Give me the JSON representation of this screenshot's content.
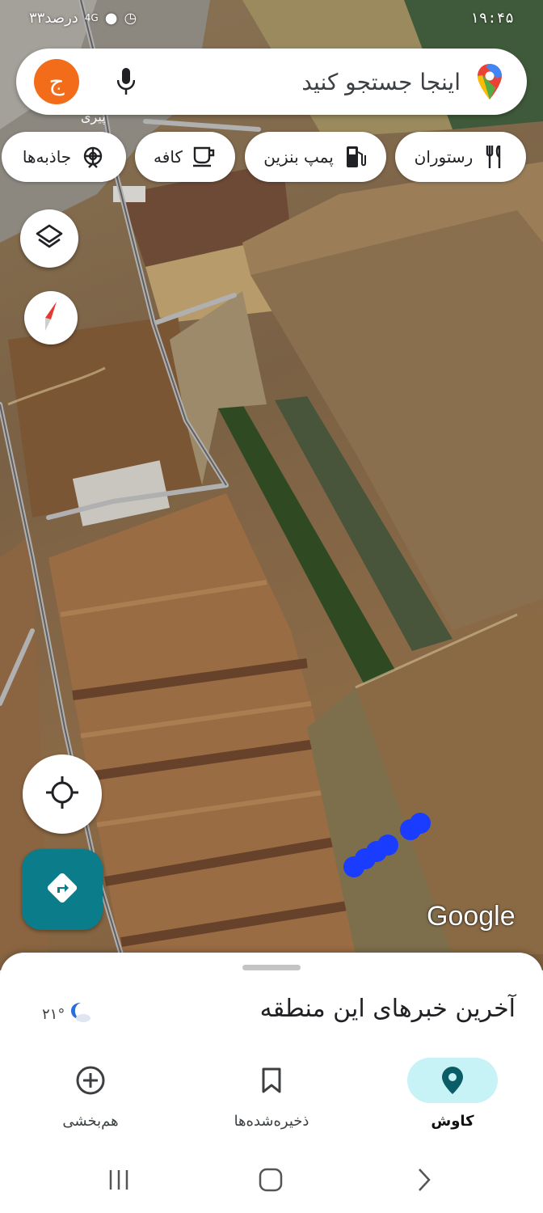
{
  "status_bar": {
    "time": "۱۹:۴۵",
    "battery": "۳۳درصد",
    "network": "4G"
  },
  "search": {
    "placeholder": "اینجا جستجو کنید",
    "avatar_letter": "ج",
    "icons": {
      "logo": "maps-pin-icon",
      "mic": "mic-icon"
    }
  },
  "chips": [
    {
      "label": "رستوران",
      "icon": "restaurant-icon"
    },
    {
      "label": "پمپ بنزین",
      "icon": "gas-station-icon"
    },
    {
      "label": "کافه",
      "icon": "cafe-icon"
    },
    {
      "label": "جاذبه‌ها",
      "icon": "attractions-icon"
    }
  ],
  "map": {
    "attribution": "Google",
    "place_label": "پیری",
    "route_color": "#1a3cff"
  },
  "sheet": {
    "news_title": "آخرین خبرهای این منطقه",
    "weather_temp": "۲۱°",
    "weather_icon": "moon-cloud-icon"
  },
  "bottom_nav": [
    {
      "label": "کاوش",
      "icon": "explore-pin-icon",
      "active": true
    },
    {
      "label": "ذخیره‌شده‌ها",
      "icon": "bookmark-icon",
      "active": false
    },
    {
      "label": "هم‌بخشی",
      "icon": "add-contribute-icon",
      "active": false
    }
  ],
  "colors": {
    "accent_teal": "#0b7c89",
    "active_nav_bg": "#c8f3f6",
    "avatar_orange": "#f26c1a"
  }
}
